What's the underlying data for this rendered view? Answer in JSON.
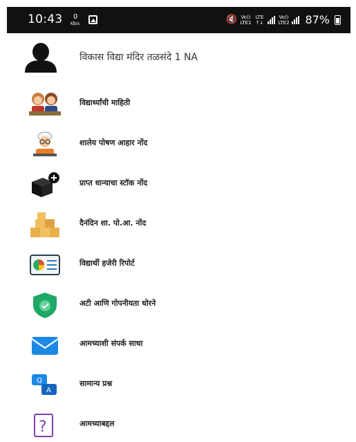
{
  "status_bar": {
    "time": "10:43",
    "data_speed_value": "0",
    "data_speed_unit": "KB/s",
    "net1": "Vo)) LTE1",
    "net2": "LTE ↑↓",
    "net3": "Vo)) LTE2",
    "battery": "87%"
  },
  "header": {
    "school_name": "विकास विद्या मंदिर तळसंदे 1 NA",
    "avatar_icon": "user-silhouette-icon"
  },
  "menu": [
    {
      "label": "विद्यार्थ्यांची माहिती",
      "icon": "students-icon"
    },
    {
      "label": "शालेय पोषण आहार नोंद",
      "icon": "cook-icon"
    },
    {
      "label": "प्राप्त धान्याचा स्टॉक नोंद",
      "icon": "box-plus-icon"
    },
    {
      "label": "दैनंदिन शा. पो.आ. नोंद",
      "icon": "boxes-icon"
    },
    {
      "label": "विद्यार्थी हजेरी रिपोर्ट",
      "icon": "report-icon"
    },
    {
      "label": "अटी आणि गोपनीयता धोरने",
      "icon": "shield-icon"
    },
    {
      "label": "आमच्याशी संपर्क साधा",
      "icon": "mail-icon"
    },
    {
      "label": "सामान्य प्रश्न",
      "icon": "qa-chat-icon"
    },
    {
      "label": "आमच्याबद्दल",
      "icon": "question-icon"
    }
  ],
  "colors": {
    "status_bar_bg": "#111111",
    "shield_green": "#1fa866",
    "mail_blue": "#1e88e5",
    "question_purple": "#7b3fb0"
  }
}
